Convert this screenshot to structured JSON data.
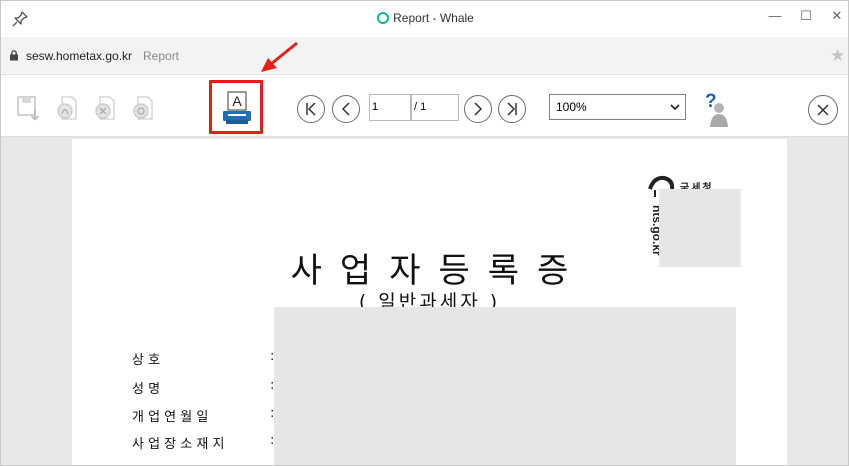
{
  "window": {
    "title": "Report - Whale",
    "controls": {
      "minimize": "—",
      "maximize": "☐",
      "close": "✕"
    }
  },
  "address": {
    "domain": "sesw.hometax.go.kr",
    "page": "Report"
  },
  "toolbar": {
    "print_glyph": "A",
    "page_current": "1",
    "page_total": "/ 1",
    "zoom_value": "100%",
    "help_glyph": "?"
  },
  "colors": {
    "annotation_red": "#e0211a",
    "whale_green": "#16b48c",
    "print_blue": "#1e6fb8"
  },
  "document": {
    "agency_name": "국세청",
    "agency_url": "nts.go.kr",
    "title": "사업자등록증",
    "subtitle": "( 일반과세자 )",
    "fields": [
      {
        "label": "상          호",
        "colon": ":"
      },
      {
        "label": "성          명",
        "colon": ":"
      },
      {
        "label": "개 업 연 월 일",
        "colon": ":"
      },
      {
        "label": "사 업 장 소 재 지",
        "colon": ":"
      }
    ]
  }
}
